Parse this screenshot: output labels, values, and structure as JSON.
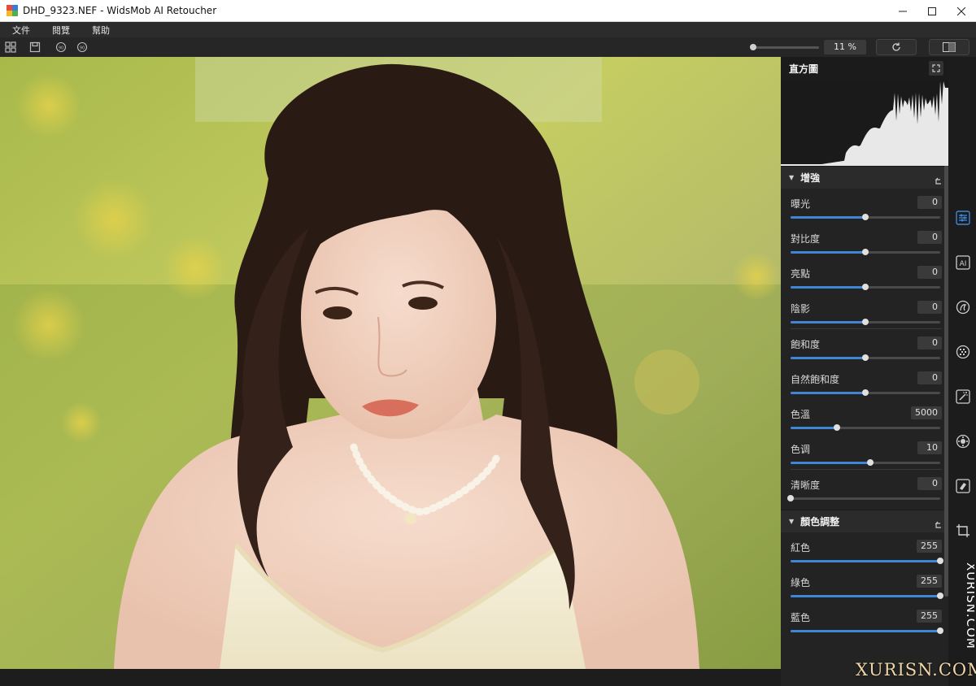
{
  "window": {
    "title": "DHD_9323.NEF - WidsMob AI Retoucher",
    "minimize": "—",
    "maximize": "☐",
    "close": "✕"
  },
  "menu": [
    "文件",
    "閱覽",
    "幫助"
  ],
  "toolbar": {
    "zoom_value": "11 %",
    "zoom_level": 0.02,
    "icons": [
      "grid-icon",
      "save-icon",
      "rotate-left-icon",
      "rotate-right-icon",
      "refresh-icon",
      "compare-icon"
    ]
  },
  "panel": {
    "title": "直方圖",
    "sections": {
      "enhance": {
        "title": "增強",
        "rows": [
          {
            "label": "曝光",
            "value": "0",
            "level": 0.5
          },
          {
            "label": "對比度",
            "value": "0",
            "level": 0.5
          },
          {
            "label": "亮點",
            "value": "0",
            "level": 0.5
          },
          {
            "label": "陰影",
            "value": "0",
            "level": 0.5
          },
          {
            "label": "飽和度",
            "value": "0",
            "level": 0.5
          },
          {
            "label": "自然飽和度",
            "value": "0",
            "level": 0.5
          },
          {
            "label": "色溫",
            "value": "5000",
            "level": 0.31
          },
          {
            "label": "色调",
            "value": "10",
            "level": 0.53
          },
          {
            "label": "清晰度",
            "value": "0",
            "level": 0.0
          }
        ]
      },
      "color": {
        "title": "顏色調整",
        "rows": [
          {
            "label": "紅色",
            "value": "255",
            "level": 1.0
          },
          {
            "label": "綠色",
            "value": "255",
            "level": 1.0
          },
          {
            "label": "藍色",
            "value": "255",
            "level": 1.0
          }
        ]
      }
    }
  },
  "tools": [
    "adjust-icon",
    "ai-icon",
    "skin-icon",
    "noise-icon",
    "magic-wand-icon",
    "settings-icon",
    "eraser-icon",
    "crop-icon"
  ],
  "accent": "#3e87d6",
  "watermark": {
    "vertical": "XURISN.COM",
    "horizontal": "XURISN.COM"
  }
}
